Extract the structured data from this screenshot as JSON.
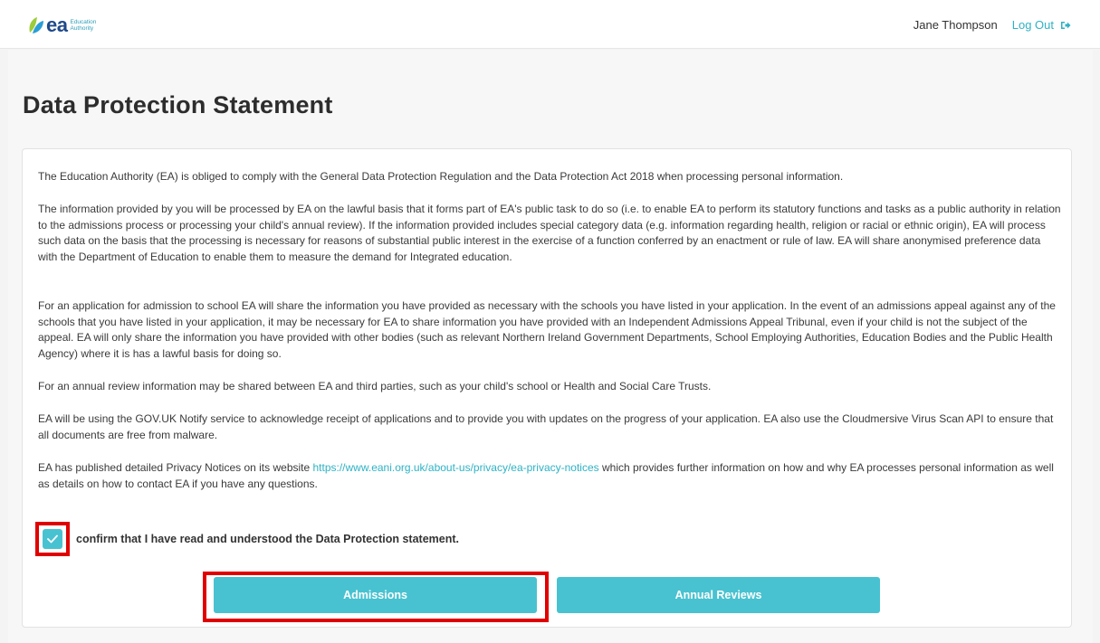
{
  "header": {
    "logo_text": "ea",
    "logo_sub_line1": "Education",
    "logo_sub_line2": "Authority",
    "user_name": "Jane Thompson",
    "logout_label": "Log Out"
  },
  "page": {
    "title": "Data Protection Statement"
  },
  "statement": {
    "p1": "The Education Authority (EA) is obliged to comply with the General Data Protection Regulation and the Data Protection Act 2018 when processing personal information.",
    "p2": "The information provided by you will be processed by EA on the lawful basis that it forms part of EA's public task to do so (i.e. to enable EA to perform its statutory functions and tasks as a public authority in relation to the admissions process or processing your child's annual review). If the information provided includes special category data (e.g. information regarding health, religion or racial or ethnic origin), EA will process such data on the basis that the processing is necessary for reasons of substantial public interest in the exercise of a function conferred by an enactment or rule of law. EA will share anonymised preference data with the Department of Education to enable them to measure the demand for Integrated education.",
    "p3": "For an application for admission to school EA will share the information you have provided as necessary with the schools you have listed in your application. In the event of an admissions appeal against any of the schools that you have listed in your application, it may be necessary for EA to share information you have provided with an Independent Admissions Appeal Tribunal, even if your child is not the subject of the appeal. EA will only share the information you have provided with other bodies (such as relevant Northern Ireland Government Departments, School Employing Authorities, Education Bodies and the Public Health Agency) where it is has a lawful basis for doing so.",
    "p4": "For an annual review information may be shared between EA and third parties, such as your child's school or Health and Social Care Trusts.",
    "p5": "EA will be using the GOV.UK Notify service to acknowledge receipt of applications and to provide you with updates on the progress of your application. EA also use the Cloudmersive Virus Scan API to ensure that all documents are free from malware.",
    "p6_before": "EA has published detailed Privacy Notices on its website ",
    "p6_link": "https://www.eani.org.uk/about-us/privacy/ea-privacy-notices",
    "p6_after": " which provides further information on how and why EA processes personal information as well as details on how to contact EA if you have any questions."
  },
  "confirm": {
    "label": "confirm that I have read and understood the Data Protection statement.",
    "checked": true
  },
  "buttons": {
    "admissions": "Admissions",
    "annual_reviews": "Annual Reviews"
  },
  "colors": {
    "accent": "#48c2d0",
    "link": "#2eb2c4",
    "highlight": "#e00000"
  }
}
